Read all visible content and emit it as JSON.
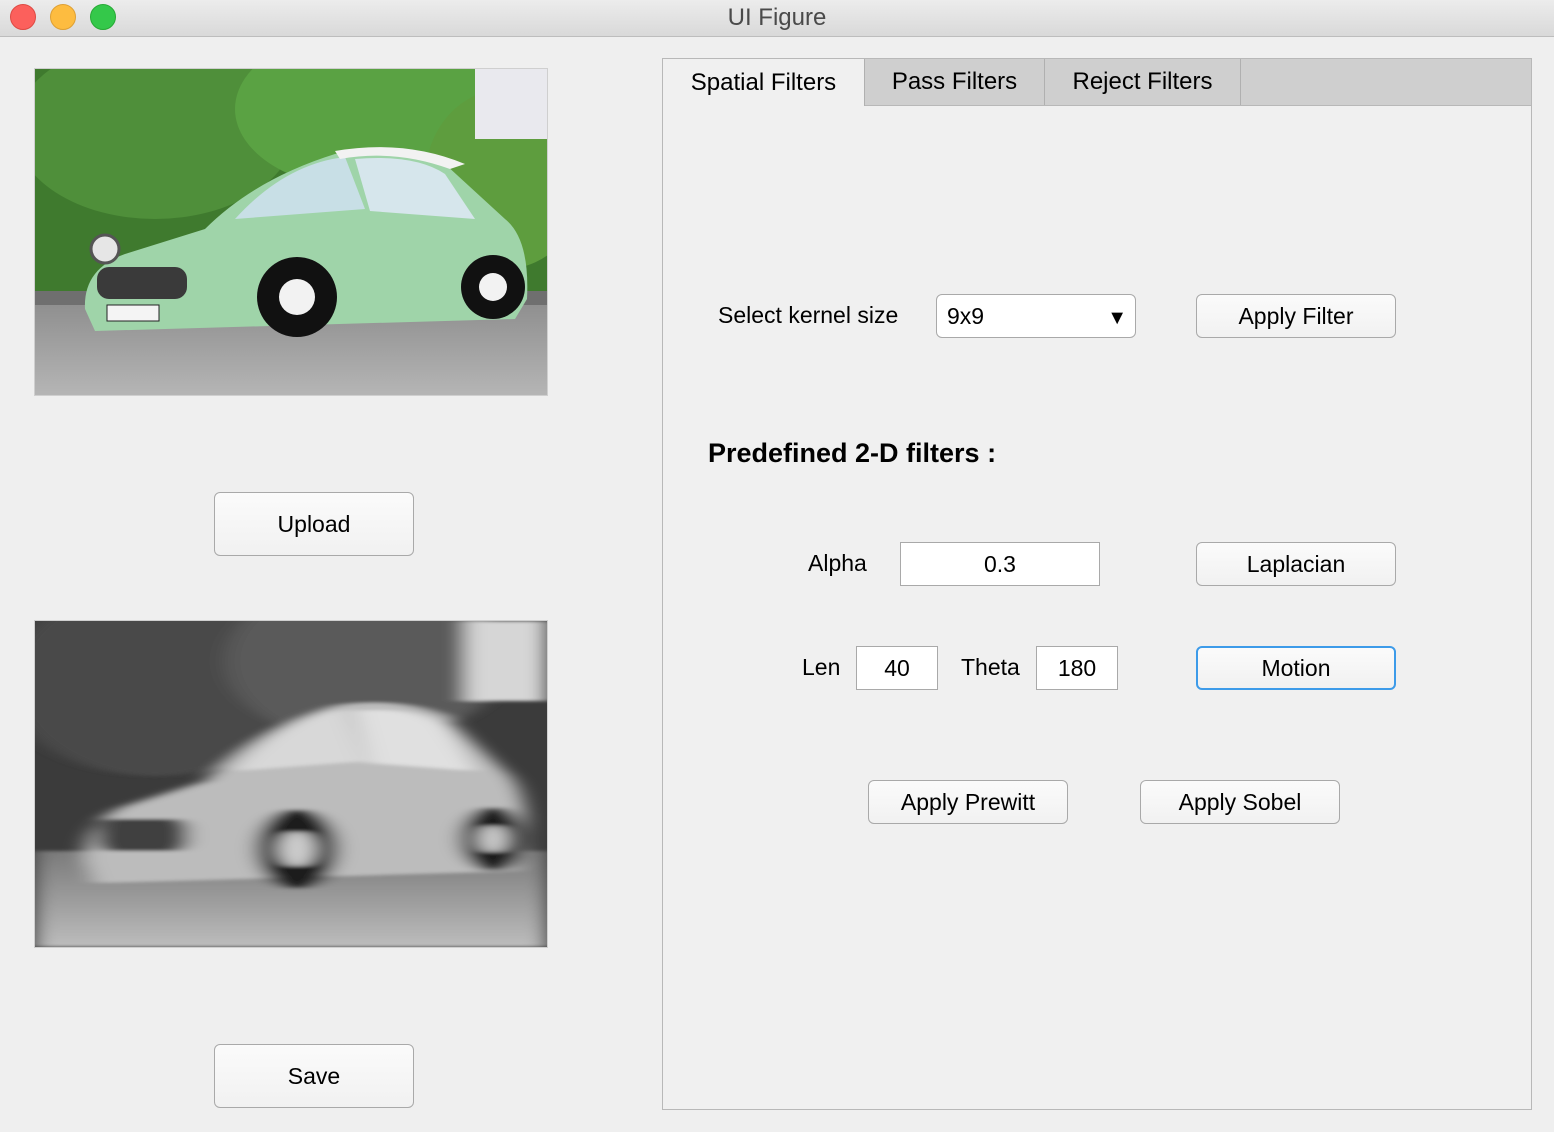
{
  "window": {
    "title": "UI Figure"
  },
  "left_panel": {
    "upload_label": "Upload",
    "save_label": "Save"
  },
  "tabs": [
    {
      "label": "Spatial Filters",
      "active": true
    },
    {
      "label": "Pass Filters",
      "active": false
    },
    {
      "label": "Reject Filters",
      "active": false
    }
  ],
  "spatial": {
    "kernel_label": "Select kernel size",
    "kernel_value": "9x9",
    "apply_filter_label": "Apply Filter",
    "predefined_heading": "Predefined 2-D filters :",
    "alpha_label": "Alpha",
    "alpha_value": "0.3",
    "laplacian_label": "Laplacian",
    "len_label": "Len",
    "len_value": "40",
    "theta_label": "Theta",
    "theta_value": "180",
    "motion_label": "Motion",
    "prewitt_label": "Apply Prewitt",
    "sobel_label": "Apply Sobel"
  },
  "colors": {
    "accent_focus": "#3d9be9",
    "car_mint": "#9fd4a9",
    "foliage": "#4e8c3a"
  },
  "icons": {
    "close": "close-window-icon",
    "minimize": "minimize-window-icon",
    "zoom": "zoom-window-icon",
    "dropdown": "chevron-down-icon"
  }
}
